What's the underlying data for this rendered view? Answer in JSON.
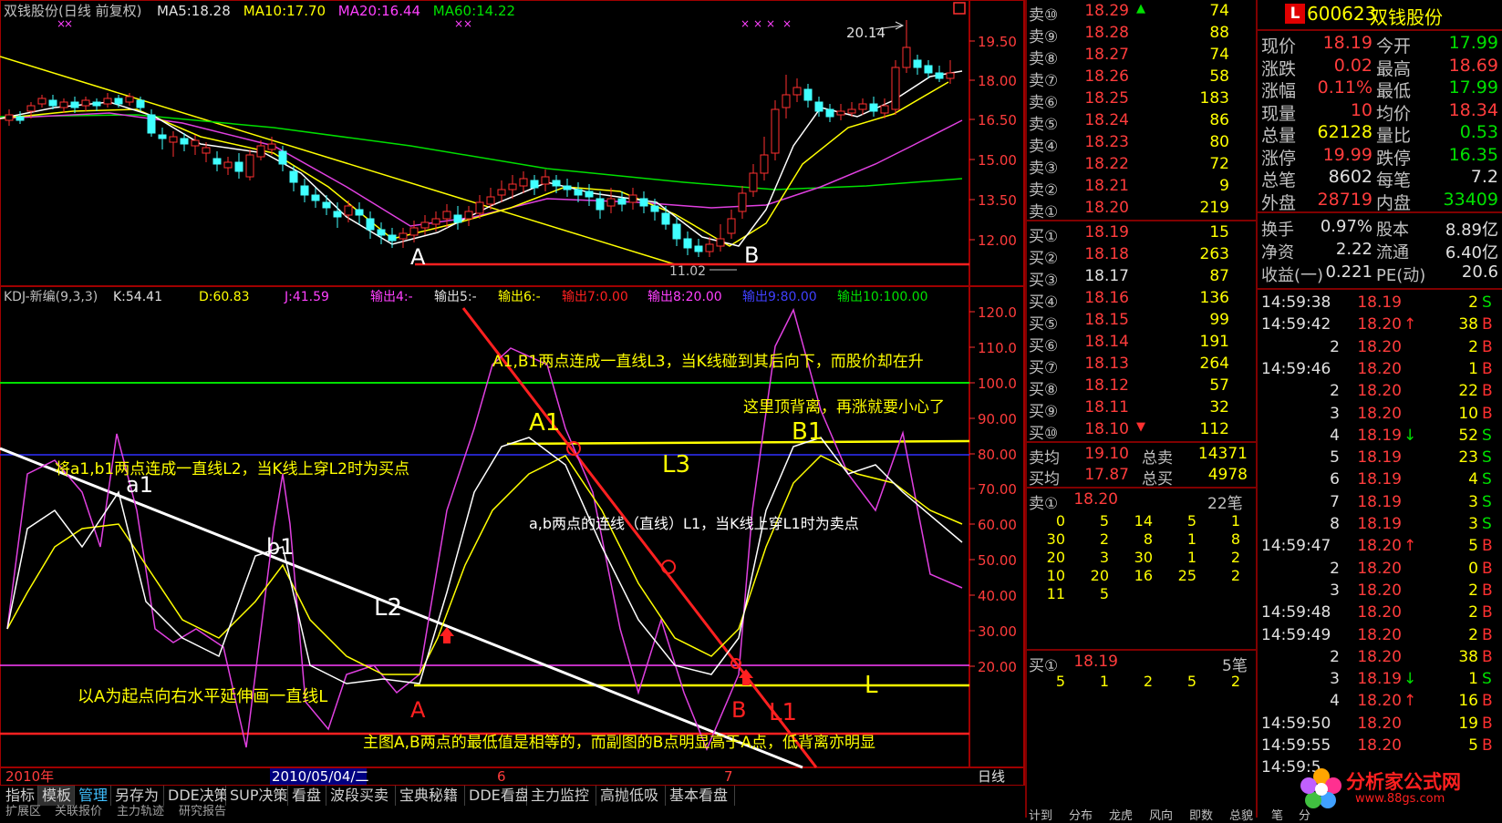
{
  "main_chart": {
    "title": "双钱股份(日线 前复权)",
    "ma": [
      {
        "label": "MA5:18.28",
        "color": "#e0e0e0"
      },
      {
        "label": "MA10:17.70",
        "color": "#ffff00"
      },
      {
        "label": "MA20:16.44",
        "color": "#ff40ff"
      },
      {
        "label": "MA60:14.22",
        "color": "#00e000"
      }
    ],
    "price_ticks": [
      "19.50",
      "18.00",
      "16.50",
      "15.00",
      "13.50",
      "12.00"
    ],
    "high_mark": "20.14",
    "point_a": "A",
    "point_b": "B",
    "date_mark": "11.02"
  },
  "kdj": {
    "title": "KDJ-新编(9,3,3)",
    "items": [
      {
        "label": "K:54.41",
        "color": "#e0e0e0"
      },
      {
        "label": "D:60.83",
        "color": "#ffff00"
      },
      {
        "label": "J:41.59",
        "color": "#ff40ff"
      },
      {
        "label": "输出4:-",
        "color": "#ff40ff"
      },
      {
        "label": "输出5:-",
        "color": "#e0e0e0"
      },
      {
        "label": "输出6:-",
        "color": "#ffff00"
      },
      {
        "label": "输出7:0.00",
        "color": "#ff2020"
      },
      {
        "label": "输出8:20.00",
        "color": "#ff40ff"
      },
      {
        "label": "输出9:80.00",
        "color": "#4040ff"
      },
      {
        "label": "输出10:100.00",
        "color": "#00e000"
      }
    ],
    "ticks": [
      "120.0",
      "110.0",
      "100.0",
      "90.00",
      "80.00",
      "70.00",
      "60.00",
      "50.00",
      "40.00",
      "30.00",
      "20.00"
    ],
    "annotations": {
      "l3_text": "A1,B1两点连成一直线L3，当K线碰到其后向下，而股价却在升",
      "top_div": "这里顶背离，再涨就要小心了",
      "l2_text": "将a1,b1两点连成一直线L2，当K线上穿L2时为买点",
      "l1_text": "a,b两点的连线（直线）L1，当K线上穿L1时为卖点",
      "l_text": "以A为起点向右水平延伸画一直线L",
      "bottom_text": "主图A,B两点的最低值是相等的，而副图的B点明显高于A点，低背离亦明显",
      "a1": "A1",
      "b1": "B1",
      "l3": "L3",
      "l2": "L2",
      "l1": "L1",
      "l": "L",
      "a_low": "a1",
      "b_low": "b1",
      "pa": "A",
      "pb": "B"
    }
  },
  "date_axis": {
    "year": "2010年",
    "cursor_date": "2010/05/04/二",
    "m6": "6",
    "m7": "7",
    "period": "日线"
  },
  "toolbar": {
    "tabs": [
      "指标",
      "模板",
      "管理",
      "另存为",
      "DDE决策",
      "SUP决策",
      "看盘",
      "波段买卖",
      "宝典秘籍",
      "DDE看盘",
      "主力监控",
      "高抛低吸",
      "基本看盘"
    ],
    "second_row": [
      "扩展区",
      "关联报价",
      "主力轨迹",
      "研究报告"
    ]
  },
  "stock": {
    "code": "600623",
    "name": "双钱股份",
    "badge": "L"
  },
  "sell_orders": [
    {
      "label": "卖⑩",
      "price": "18.29",
      "vol": "74",
      "flag": "▲"
    },
    {
      "label": "卖⑨",
      "price": "18.28",
      "vol": "88",
      "flag": ""
    },
    {
      "label": "卖⑧",
      "price": "18.27",
      "vol": "74",
      "flag": ""
    },
    {
      "label": "卖⑦",
      "price": "18.26",
      "vol": "58",
      "flag": ""
    },
    {
      "label": "卖⑥",
      "price": "18.25",
      "vol": "183",
      "flag": ""
    },
    {
      "label": "卖⑤",
      "price": "18.24",
      "vol": "86",
      "flag": ""
    },
    {
      "label": "卖④",
      "price": "18.23",
      "vol": "80",
      "flag": ""
    },
    {
      "label": "卖③",
      "price": "18.22",
      "vol": "72",
      "flag": ""
    },
    {
      "label": "卖②",
      "price": "18.21",
      "vol": "9",
      "flag": ""
    },
    {
      "label": "卖①",
      "price": "18.20",
      "vol": "219",
      "flag": ""
    }
  ],
  "buy_orders": [
    {
      "label": "买①",
      "price": "18.19",
      "vol": "15",
      "flag": "",
      "white": false
    },
    {
      "label": "买②",
      "price": "18.18",
      "vol": "263",
      "flag": "",
      "white": false
    },
    {
      "label": "买③",
      "price": "18.17",
      "vol": "87",
      "flag": "",
      "white": true
    },
    {
      "label": "买④",
      "price": "18.16",
      "vol": "136",
      "flag": "",
      "white": false
    },
    {
      "label": "买⑤",
      "price": "18.15",
      "vol": "99",
      "flag": "",
      "white": false
    },
    {
      "label": "买⑥",
      "price": "18.14",
      "vol": "191",
      "flag": "",
      "white": false
    },
    {
      "label": "买⑦",
      "price": "18.13",
      "vol": "264",
      "flag": "",
      "white": false
    },
    {
      "label": "买⑧",
      "price": "18.12",
      "vol": "57",
      "flag": "",
      "white": false
    },
    {
      "label": "买⑨",
      "price": "18.11",
      "vol": "32",
      "flag": "",
      "white": false
    },
    {
      "label": "买⑩",
      "price": "18.10",
      "vol": "112",
      "flag": "▼",
      "white": false
    }
  ],
  "averages": [
    {
      "label": "卖均",
      "price": "19.10",
      "label2": "总卖",
      "vol": "14371"
    },
    {
      "label": "买均",
      "price": "17.87",
      "label2": "总买",
      "vol": "4978"
    }
  ],
  "queue_sell": {
    "label": "卖①",
    "price": "18.20",
    "count": "22笔",
    "rows": [
      [
        "0",
        "5",
        "14",
        "5",
        "1"
      ],
      [
        "30",
        "2",
        "8",
        "1",
        "8"
      ],
      [
        "20",
        "3",
        "30",
        "1",
        "2"
      ],
      [
        "10",
        "20",
        "16",
        "25",
        "2"
      ],
      [
        "11",
        "5",
        "",
        "",
        ""
      ]
    ]
  },
  "queue_buy": {
    "label": "买①",
    "price": "18.19",
    "count": "5笔",
    "rows": [
      [
        "5",
        "1",
        "2",
        "5",
        "2"
      ]
    ]
  },
  "quote": [
    {
      "l1": "现价",
      "v1": "18.19",
      "c1": "red",
      "l2": "今开",
      "v2": "17.99",
      "c2": "grn"
    },
    {
      "l1": "涨跌",
      "v1": "0.02",
      "c1": "red",
      "l2": "最高",
      "v2": "18.69",
      "c2": "red"
    },
    {
      "l1": "涨幅",
      "v1": "0.11%",
      "c1": "red",
      "l2": "最低",
      "v2": "17.99",
      "c2": "grn"
    },
    {
      "l1": "现量",
      "v1": "10",
      "c1": "red",
      "l2": "均价",
      "v2": "18.34",
      "c2": "red"
    },
    {
      "l1": "总量",
      "v1": "62128",
      "c1": "yel",
      "l2": "量比",
      "v2": "0.53",
      "c2": "grn"
    },
    {
      "l1": "涨停",
      "v1": "19.99",
      "c1": "red",
      "l2": "跌停",
      "v2": "16.35",
      "c2": "grn"
    },
    {
      "l1": "总笔",
      "v1": "8602",
      "c1": "wht",
      "l2": "每笔",
      "v2": "7.2",
      "c2": "wht"
    },
    {
      "l1": "外盘",
      "v1": "28719",
      "c1": "red",
      "l2": "内盘",
      "v2": "33409",
      "c2": "grn"
    }
  ],
  "finance": [
    {
      "l1": "换手",
      "v1": "0.97%",
      "l2": "股本",
      "v2": "8.89亿"
    },
    {
      "l1": "净资",
      "v1": "2.22",
      "l2": "流通",
      "v2": "6.40亿"
    },
    {
      "l1": "收益(一)",
      "v1": "0.221",
      "l2": "PE(动)",
      "v2": "20.6"
    }
  ],
  "ticks_list": [
    {
      "time": "14:59:38",
      "price": "18.19",
      "arrow": "",
      "vol": "2",
      "side": "S"
    },
    {
      "time": "14:59:42",
      "price": "18.20",
      "arrow": "↑",
      "vol": "38",
      "side": "B"
    },
    {
      "time": "2",
      "price": "18.20",
      "arrow": "",
      "vol": "2",
      "side": "B"
    },
    {
      "time": "14:59:46",
      "price": "18.20",
      "arrow": "",
      "vol": "1",
      "side": "B"
    },
    {
      "time": "2",
      "price": "18.20",
      "arrow": "",
      "vol": "22",
      "side": "B"
    },
    {
      "time": "3",
      "price": "18.20",
      "arrow": "",
      "vol": "10",
      "side": "B"
    },
    {
      "time": "4",
      "price": "18.19",
      "arrow": "↓",
      "vol": "52",
      "side": "S"
    },
    {
      "time": "5",
      "price": "18.19",
      "arrow": "",
      "vol": "23",
      "side": "S"
    },
    {
      "time": "6",
      "price": "18.19",
      "arrow": "",
      "vol": "4",
      "side": "S"
    },
    {
      "time": "7",
      "price": "18.19",
      "arrow": "",
      "vol": "3",
      "side": "S"
    },
    {
      "time": "8",
      "price": "18.19",
      "arrow": "",
      "vol": "3",
      "side": "S"
    },
    {
      "time": "14:59:47",
      "price": "18.20",
      "arrow": "↑",
      "vol": "5",
      "side": "B"
    },
    {
      "time": "2",
      "price": "18.20",
      "arrow": "",
      "vol": "0",
      "side": "B"
    },
    {
      "time": "3",
      "price": "18.20",
      "arrow": "",
      "vol": "2",
      "side": "B"
    },
    {
      "time": "14:59:48",
      "price": "18.20",
      "arrow": "",
      "vol": "2",
      "side": "B"
    },
    {
      "time": "14:59:49",
      "price": "18.20",
      "arrow": "",
      "vol": "2",
      "side": "B"
    },
    {
      "time": "2",
      "price": "18.20",
      "arrow": "",
      "vol": "38",
      "side": "B"
    },
    {
      "time": "3",
      "price": "18.19",
      "arrow": "↓",
      "vol": "1",
      "side": "S"
    },
    {
      "time": "4",
      "price": "18.20",
      "arrow": "↑",
      "vol": "16",
      "side": "B"
    },
    {
      "time": "14:59:50",
      "price": "18.20",
      "arrow": "",
      "vol": "19",
      "side": "B"
    },
    {
      "time": "14:59:55",
      "price": "18.20",
      "arrow": "",
      "vol": "5",
      "side": "B"
    },
    {
      "time": "14:59:5",
      "price": "",
      "arrow": "",
      "vol": "",
      "side": ""
    }
  ],
  "bottom_tabs": [
    "计到",
    "分布",
    "龙虎",
    "风向",
    "即数",
    "总貌",
    "笔",
    "分"
  ],
  "watermark": {
    "text": "分析家公式网",
    "url": "www.88gs.com"
  }
}
